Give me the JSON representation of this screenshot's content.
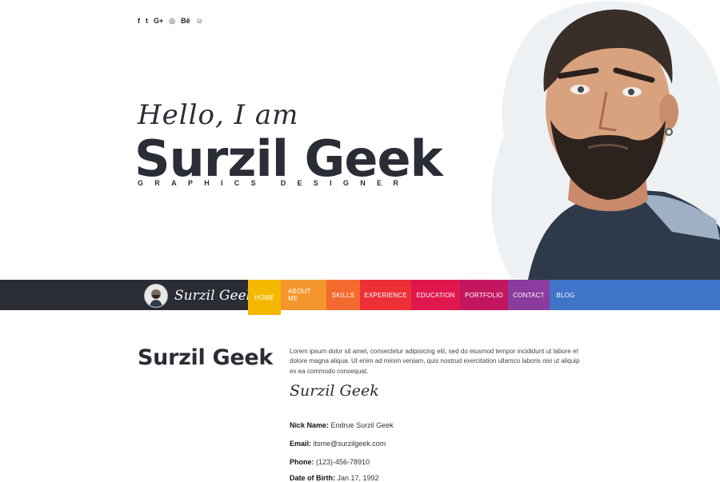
{
  "social": [
    {
      "icon": "facebook-icon",
      "glyph": "f"
    },
    {
      "icon": "twitter-icon",
      "glyph": "t"
    },
    {
      "icon": "google-plus-icon",
      "glyph": "G+"
    },
    {
      "icon": "dribbble-icon",
      "glyph": "◎"
    },
    {
      "icon": "behance-icon",
      "glyph": "Bē"
    },
    {
      "icon": "github-icon",
      "glyph": "☺"
    }
  ],
  "hero": {
    "greeting": "Hello, I am",
    "name": "Surzil Geek",
    "role": "GRAPHICS DESIGNER"
  },
  "nav": {
    "brand": "Surzil Geek",
    "items": [
      {
        "label": "HOME",
        "color": "#f5b800",
        "active": true
      },
      {
        "label": "ABOUT ME",
        "color": "#f5962d"
      },
      {
        "label": "SKILLS",
        "color": "#f26a2e"
      },
      {
        "label": "EXPERIENCE",
        "color": "#ec3036"
      },
      {
        "label": "EDUCATION",
        "color": "#e0174d"
      },
      {
        "label": "PORTFOLIO",
        "color": "#c2175f"
      },
      {
        "label": "CONTACT",
        "color": "#8b3c9e"
      },
      {
        "label": "BLOG",
        "color": "#3f74c8"
      }
    ]
  },
  "about": {
    "title": "Surzil Geek",
    "bio": "Lorem ipsum dolor sit amet, consectetur adipisicing elit, sed do eiusmod tempor incididunt ut labore et dolore magna aliqua. Ut enim ad minim veniam, quis nostrud exercitation ullamco laboris nisi ut aliquip ex ea commodo consequat.",
    "signature": "Surzil Geek",
    "details": [
      {
        "label": "Nick Name:",
        "value": "Endrue Surzil Geek"
      },
      {
        "label": "Email:",
        "value": "itsme@surzilgeek.com"
      },
      {
        "label": "Phone:",
        "value": "(123)-456-78910"
      },
      {
        "label": "Date of Birth:",
        "value": "Jan 17, 1992"
      }
    ]
  },
  "colors": {
    "dark": "#2b2d36",
    "blue": "#3f74c8"
  }
}
